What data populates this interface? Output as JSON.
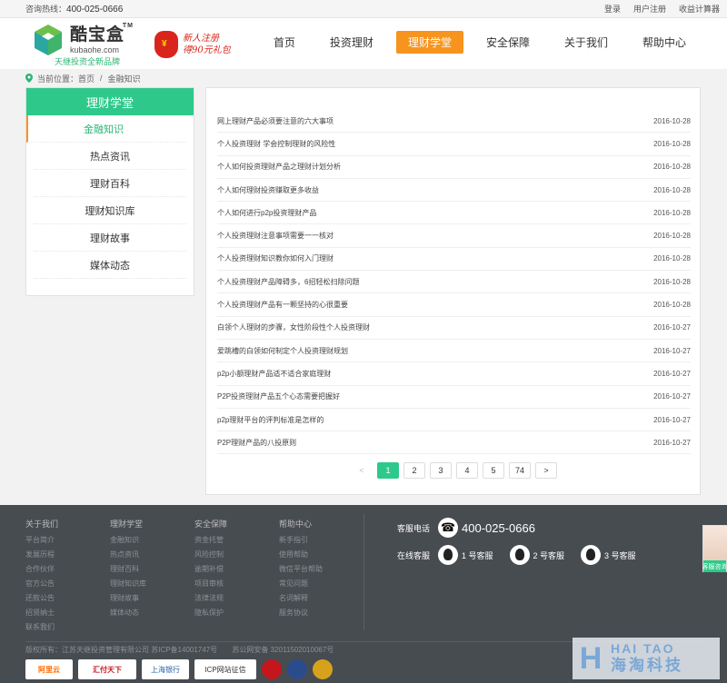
{
  "topbar": {
    "hotline_label": "咨询热线：",
    "hotline": "400-025-0666",
    "links": [
      "登录",
      "用户注册",
      "收益计算器"
    ]
  },
  "header": {
    "logo_name": "酷宝盒",
    "logo_tm": "TM",
    "logo_domain": "kubaohe.com",
    "logo_slogan": "天继投资全新品牌",
    "promo_line1": "新人注册",
    "promo_line2": "得90元礼包",
    "nav": [
      "首页",
      "投资理财",
      "理财学堂",
      "安全保障",
      "关于我们",
      "帮助中心"
    ],
    "nav_active_index": 2
  },
  "breadcrumb": {
    "prefix": "当前位置：",
    "home": "首页",
    "sep": "/",
    "current": "金融知识"
  },
  "sidebar": {
    "title": "理财学堂",
    "items": [
      "金融知识",
      "热点资讯",
      "理财百科",
      "理财知识库",
      "理财故事",
      "媒体动态"
    ],
    "active_index": 0
  },
  "articles": [
    {
      "title": "网上理财产品必须要注意的六大事项",
      "date": "2016-10-28"
    },
    {
      "title": "个人投资理财 学会控制理财的风险性",
      "date": "2016-10-28"
    },
    {
      "title": "个人如何投资理财产品之理财计划分析",
      "date": "2016-10-28"
    },
    {
      "title": "个人如何理财投资赚取更多收益",
      "date": "2016-10-28"
    },
    {
      "title": "个人如何进行p2p投资理财产品",
      "date": "2016-10-28"
    },
    {
      "title": "个人投资理财注意事项需要一一核对",
      "date": "2016-10-28"
    },
    {
      "title": "个人投资理财知识教你如何入门理财",
      "date": "2016-10-28"
    },
    {
      "title": "个人投资理财产品障碍多，6招轻松扫除问题",
      "date": "2016-10-28"
    },
    {
      "title": "个人投资理财产品有一颗坚持的心很重要",
      "date": "2016-10-28"
    },
    {
      "title": "白领个人理财的步骤，女性阶段性个人投资理财",
      "date": "2016-10-27"
    },
    {
      "title": "爱跳槽的白领如何制定个人投资理财规划",
      "date": "2016-10-27"
    },
    {
      "title": "p2p小额理财产品适不适合家庭理财",
      "date": "2016-10-27"
    },
    {
      "title": "P2P投资理财产品五个心态需要把握好",
      "date": "2016-10-27"
    },
    {
      "title": "p2p理财平台的评判标准是怎样的",
      "date": "2016-10-27"
    },
    {
      "title": "P2P理财产品的八投原则",
      "date": "2016-10-27"
    }
  ],
  "pager": {
    "prev": "<",
    "pages": [
      "1",
      "2",
      "3",
      "4",
      "5",
      "74"
    ],
    "current": "1",
    "next": ">"
  },
  "footer": {
    "columns": [
      {
        "heading": "关于我们",
        "links": [
          "平台简介",
          "发展历程",
          "合作伙伴",
          "官方公告",
          "还款公告",
          "招贤纳士",
          "联系我们"
        ]
      },
      {
        "heading": "理财学堂",
        "links": [
          "金融知识",
          "热点资讯",
          "理财百科",
          "理财知识库",
          "理财故事",
          "媒体动态"
        ]
      },
      {
        "heading": "安全保障",
        "links": [
          "资金托管",
          "风险控制",
          "逾期补偿",
          "项目审核",
          "法律法规",
          "隐私保护"
        ]
      },
      {
        "heading": "帮助中心",
        "links": [
          "新手指引",
          "使用帮助",
          "微信平台帮助",
          "常见问题",
          "名词解释",
          "服务协议"
        ]
      }
    ],
    "phone_label": "客服电话",
    "phone": "400-025-0666",
    "online_label": "在线客服",
    "agents": [
      "1 号客服",
      "2 号客服",
      "3 号客服"
    ],
    "copyright": "版权所有：江苏天继投资管理有限公司 苏ICP备14001747号",
    "police": "苏公网安备 32011502010067号",
    "badges": [
      "阿里云",
      "汇付天下",
      "上海银行",
      "ICP网站征信"
    ]
  },
  "service_tag": "客服咨询",
  "watermark": {
    "en": "HAI TAO",
    "cn": "海淘科技"
  },
  "colors": {
    "brand_green": "#2ec98a",
    "accent_orange": "#f7941d",
    "footer_bg": "#474c51"
  }
}
